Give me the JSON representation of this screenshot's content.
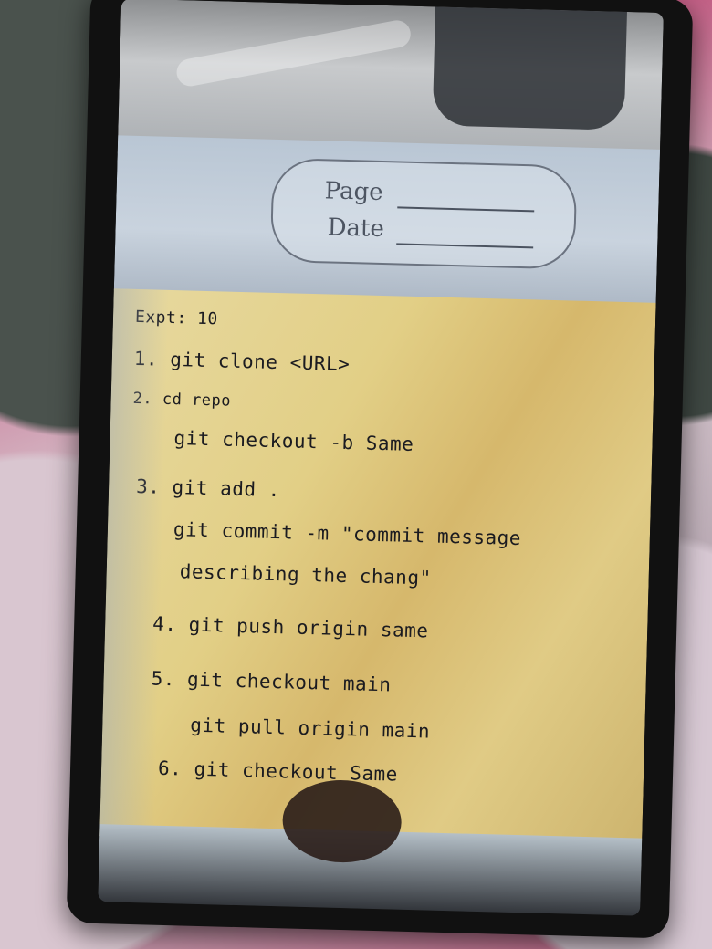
{
  "header": {
    "page_label": "Page",
    "date_label": "Date"
  },
  "notes": {
    "title": "Expt: 10",
    "lines": [
      "1. git clone <URL>",
      "2. cd repo",
      "git checkout -b Same",
      "3. git add .",
      "git commit -m \"commit message",
      "describing the chang\"",
      "4. git push origin same",
      "5. git checkout main",
      "git pull origin main",
      "6.  git checkout Same"
    ]
  }
}
